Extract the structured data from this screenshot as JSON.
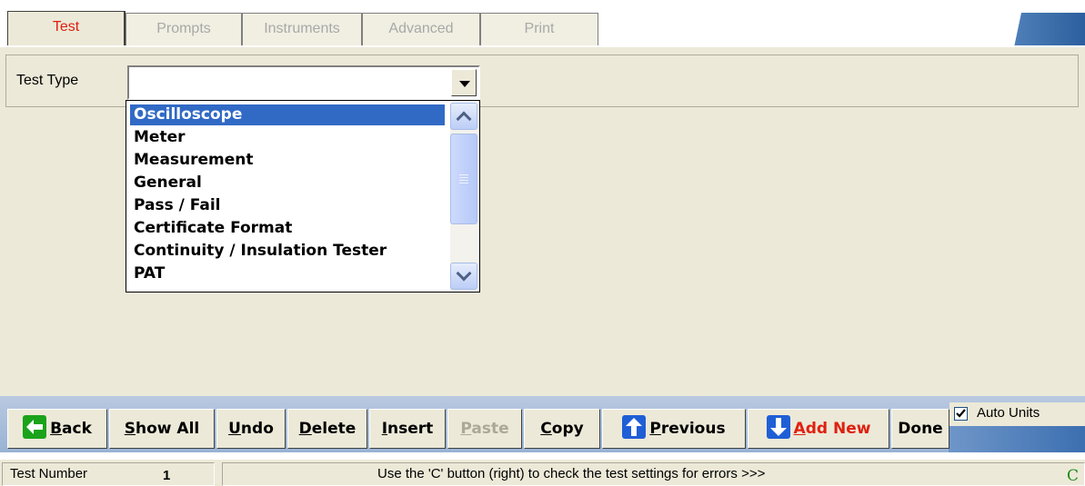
{
  "tabs": [
    {
      "label": "Test",
      "active": true
    },
    {
      "label": "Prompts",
      "active": false
    },
    {
      "label": "Instruments",
      "active": false
    },
    {
      "label": "Advanced",
      "active": false
    },
    {
      "label": "Print",
      "active": false
    }
  ],
  "test_type": {
    "label": "Test Type",
    "value": "",
    "options": [
      "Oscilloscope",
      "Meter",
      "Measurement",
      "General",
      "Pass / Fail",
      "Certificate Format",
      "Continuity / Insulation Tester",
      "PAT"
    ],
    "highlighted": "Oscilloscope"
  },
  "toolbar": {
    "back": {
      "mnemonic": "B",
      "rest": "ack"
    },
    "show_all": {
      "mnemonic": "S",
      "rest": "how All"
    },
    "undo": {
      "mnemonic": "U",
      "rest": "ndo"
    },
    "delete": {
      "mnemonic": "D",
      "rest": "elete"
    },
    "insert": {
      "mnemonic": "I",
      "rest": "nsert"
    },
    "paste": {
      "mnemonic": "P",
      "rest": "aste"
    },
    "copy": {
      "mnemonic": "C",
      "rest": "opy"
    },
    "previous": {
      "mnemonic": "P",
      "rest": "revious"
    },
    "add_new": {
      "mnemonic": "A",
      "rest": "dd New"
    },
    "done": "Done",
    "auto_units": {
      "label": "Auto Units",
      "checked": true
    }
  },
  "status": {
    "test_number_label": "Test Number",
    "test_number": "1",
    "message": "Use the 'C' button (right) to check the test settings for errors >>>",
    "check_button": "C"
  },
  "colors": {
    "accent_red": "#e02010",
    "selection": "#316ac5",
    "panel": "#ece9d8",
    "arrow_green": "#1aa31a",
    "arrow_blue": "#1f5fd6"
  },
  "icons": {
    "back": "back-arrow-icon",
    "previous": "up-arrow-icon",
    "add_new": "down-arrow-icon"
  }
}
